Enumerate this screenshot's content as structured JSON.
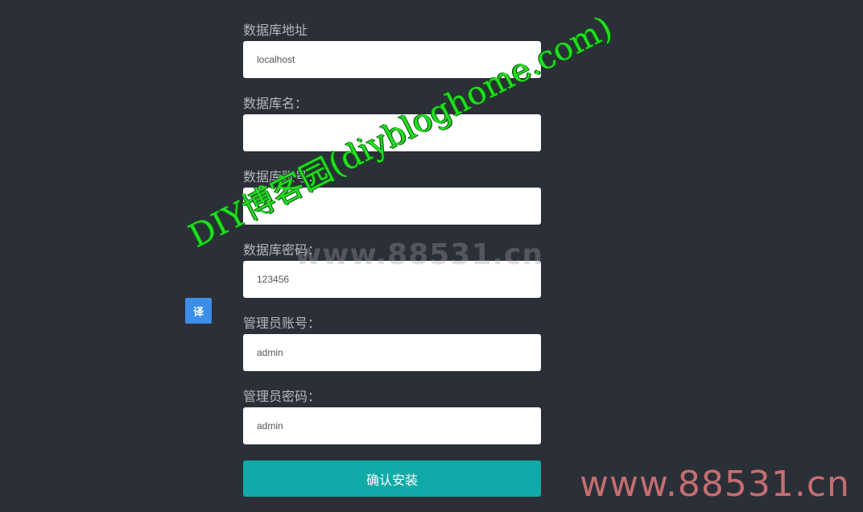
{
  "form": {
    "fields": [
      {
        "label": "数据库地址",
        "value": "localhost",
        "placeholder": ""
      },
      {
        "label": "数据库名：",
        "value": "",
        "placeholder": ""
      },
      {
        "label": "数据库账号：",
        "value": "",
        "placeholder": ""
      },
      {
        "label": "数据库密码：",
        "value": "123456",
        "placeholder": ""
      },
      {
        "label": "管理员账号：",
        "value": "admin",
        "placeholder": ""
      },
      {
        "label": "管理员密码：",
        "value": "admin",
        "placeholder": ""
      }
    ],
    "submit_label": "确认安装"
  },
  "translate_button": {
    "label": "译"
  },
  "watermarks": {
    "center": "www.88531.cn",
    "corner": "www.88531.cn",
    "diagonal": "DIY博客园(diybloghome.com)"
  },
  "colors": {
    "background": "#2b2f38",
    "label": "#b4b8c0",
    "submit": "#10aaa8",
    "translate": "#3d8ee8",
    "watermark_green": "#22dd22",
    "watermark_red": "#e07a7a"
  }
}
